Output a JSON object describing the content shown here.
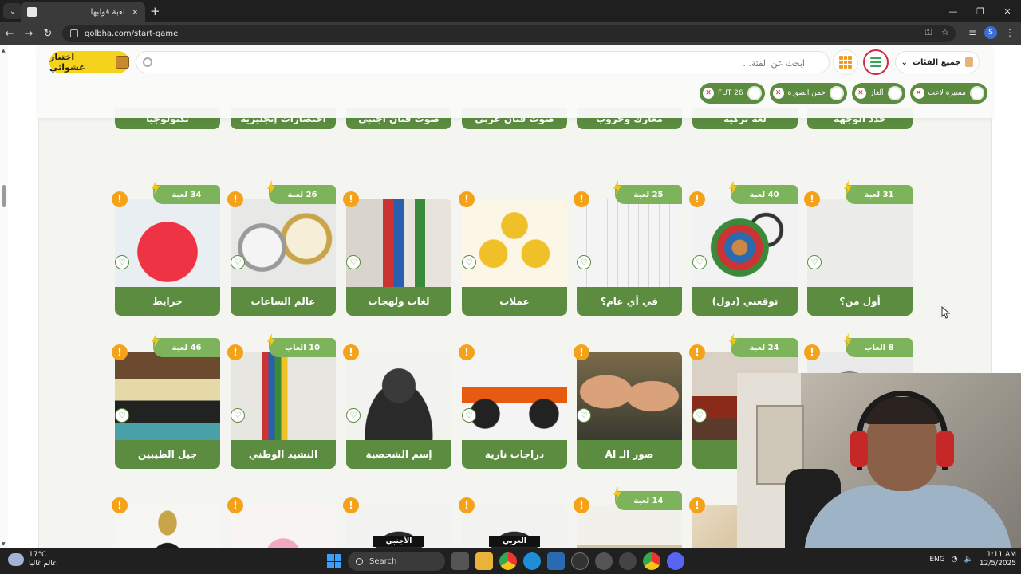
{
  "browser": {
    "tab_title": "لعبة قولبها",
    "url": "golbha.com/start-game",
    "profile_initial": "S"
  },
  "topbar": {
    "random_button": "اختيار عشوائي",
    "search_placeholder": "ابحث عن الفئة...",
    "category_select": "جميع الفئات"
  },
  "chips": [
    {
      "label": "مسيرة لاعب"
    },
    {
      "label": "ألغاز"
    },
    {
      "label": "خمن الصورة"
    },
    {
      "label": "FUT 26"
    }
  ],
  "top_row": [
    {
      "label": "تكنولوجيا"
    },
    {
      "label": "اختصارات إنجليزية"
    },
    {
      "label": "صوت فنان اجنبي"
    },
    {
      "label": "صوت فنان عربي"
    },
    {
      "label": "معارك وحروب"
    },
    {
      "label": "لغة تركية"
    },
    {
      "label": "حدد الوجهة"
    }
  ],
  "row1": [
    {
      "label": "خرايط",
      "badge": "34 لعبة",
      "image": "red-world-map"
    },
    {
      "label": "عالم الساعات",
      "badge": "26 لعبة",
      "image": "wrist-watches"
    },
    {
      "label": "لغات ولهجات",
      "badge": "",
      "image": "flags-board"
    },
    {
      "label": "عملات",
      "badge": "",
      "image": "currency-symbols"
    },
    {
      "label": "في أي عام؟",
      "badge": "25 لعبة",
      "image": "calendar-writing"
    },
    {
      "label": "توقعني (دول)",
      "badge": "40 لعبة",
      "image": "globe-magnifier"
    },
    {
      "label": "أول من؟",
      "badge": "31 لعبة",
      "image": "first-place-sketch"
    }
  ],
  "row2": [
    {
      "label": "جيل الطيبين",
      "badge": "46 لعبة",
      "image": "retro-items"
    },
    {
      "label": "النشيد الوطني",
      "badge": "10 العاب",
      "image": "flag-poles"
    },
    {
      "label": "إسم الشخصية",
      "badge": "",
      "image": "portrait-sketch"
    },
    {
      "label": "دراجات نارية",
      "badge": "",
      "image": "motorbike"
    },
    {
      "label": "صور الـ AI",
      "badge": "",
      "image": "ai-portraits"
    },
    {
      "label": "ن",
      "badge": "24 لعبة",
      "image": "pagoda"
    },
    {
      "label": "",
      "badge": "8 العاب",
      "image": "astronaut"
    }
  ],
  "row3": [
    {
      "badge": "",
      "image": "perfume-bottle-black"
    },
    {
      "badge": "",
      "image": "perfume-bottle-pink"
    },
    {
      "badge": "",
      "image": "blindfold-foreign",
      "overlay": "الأجنبي"
    },
    {
      "badge": "",
      "image": "blindfold-arabic",
      "overlay": "العربي"
    },
    {
      "badge": "14 لعبة",
      "image": "pyramids"
    },
    {
      "badge": "",
      "image": "landmarks"
    }
  ],
  "taskbar": {
    "temperature": "17°C",
    "weather_text": "عالم غالبا",
    "search_label": "Search",
    "language": "ENG",
    "time": "1:11 AM",
    "date": "12/5/2025"
  },
  "colors": {
    "card_green": "#5b8c3f",
    "badge_green": "#7db35b",
    "info_orange": "#f5a21b",
    "random_yellow": "#f5d21b"
  }
}
